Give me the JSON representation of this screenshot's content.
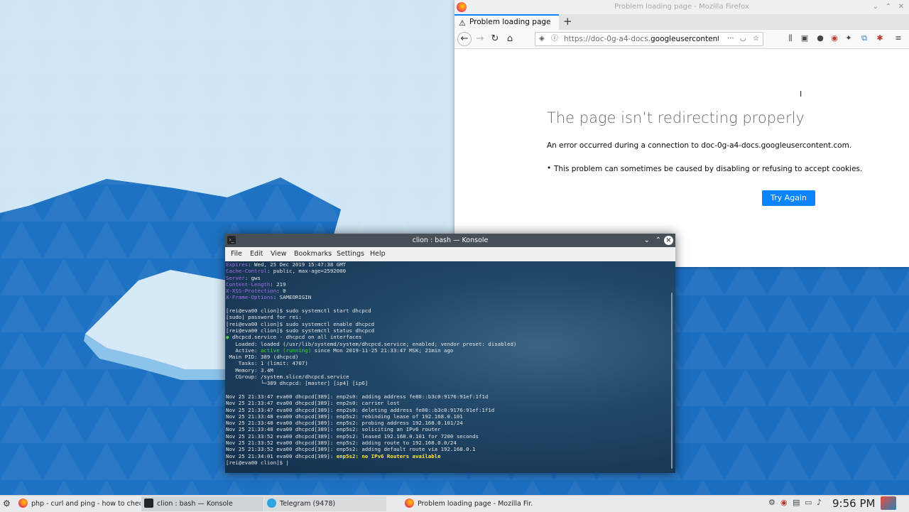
{
  "firefox": {
    "window_title": "Problem loading page - Mozilla Firefox",
    "tab_label": "Problem loading page",
    "url_prefix": "https://doc-0g-a4-docs.",
    "url_host": "googleusercontent.com",
    "error_title": "The page isn’t redirecting properly",
    "error_desc": "An error occurred during a connection to doc-0g-a4-docs.googleusercontent.com.",
    "error_bullet": "This problem can sometimes be caused by disabling or refusing to accept cookies.",
    "try_again_label": "Try Again"
  },
  "konsole": {
    "window_title": "clion : bash — Konsole",
    "menu": [
      "File",
      "Edit",
      "View",
      "Bookmarks",
      "Settings",
      "Help"
    ],
    "lines": [
      {
        "k": "Expires",
        "v": ": Wed, 25 Dec 2019 15:47:38 GMT"
      },
      {
        "k": "Cache-Control",
        "v": ": public, max-age=2592000"
      },
      {
        "k": "Server",
        "v": ": gws"
      },
      {
        "k": "Content-Length",
        "v": ": 219"
      },
      {
        "k": "X-XSS-Protection",
        "v": ": 0"
      },
      {
        "k": "X-Frame-Options",
        "v": ": SAMEORIGIN"
      },
      {
        "t": ""
      },
      {
        "t": "[rei@eva00 clion]$ sudo systemctl start dhcpcd"
      },
      {
        "t": "[sudo] password for rei:"
      },
      {
        "t": "[rei@eva00 clion]$ sudo systemctl enable dhcpcd"
      },
      {
        "t": "[rei@eva00 clion]$ sudo systemctl status dhcpcd"
      },
      {
        "dot": "●",
        "t": " dhcpcd.service - dhcpcd on all interfaces"
      },
      {
        "t": "   Loaded: loaded (/usr/lib/systemd/system/dhcpcd.service; enabled; vendor preset: disabled)"
      },
      {
        "pre": "   Active: ",
        "g": "active (running)",
        "t": " since Mon 2019-11-25 21:33:47 MSK; 21min ago"
      },
      {
        "t": " Main PID: 389 (dhcpcd)"
      },
      {
        "t": "    Tasks: 1 (limit: 4707)"
      },
      {
        "t": "   Memory: 3.4M"
      },
      {
        "t": "   CGroup: /system.slice/dhcpcd.service"
      },
      {
        "t": "           └─389 dhcpcd: [master] [ip4] [ip6]"
      },
      {
        "t": ""
      },
      {
        "t": "Nov 25 21:33:47 eva00 dhcpcd[389]: enp2s0: adding address fe80::b3c0:9176:91ef:1f1d"
      },
      {
        "t": "Nov 25 21:33:47 eva00 dhcpcd[389]: enp2s0: carrier lost"
      },
      {
        "t": "Nov 25 21:33:47 eva00 dhcpcd[389]: enp2s0: deleting address fe80::b3c0:9176:91ef:1f1d"
      },
      {
        "t": "Nov 25 21:33:48 eva00 dhcpcd[389]: enp5s2: rebinding lease of 192.168.0.101"
      },
      {
        "t": "Nov 25 21:33:48 eva00 dhcpcd[389]: enp5s2: probing address 192.168.0.101/24"
      },
      {
        "t": "Nov 25 21:33:48 eva00 dhcpcd[389]: enp5s2: soliciting an IPv6 router"
      },
      {
        "t": "Nov 25 21:33:52 eva00 dhcpcd[389]: enp5s2: leased 192.168.0.101 for 7200 seconds"
      },
      {
        "t": "Nov 25 21:33:52 eva00 dhcpcd[389]: enp5s2: adding route to 192.168.0.0/24"
      },
      {
        "t": "Nov 25 21:33:52 eva00 dhcpcd[389]: enp5s2: adding default route via 192.168.0.1"
      },
      {
        "t": "Nov 25 21:34:01 eva00 dhcpcd[389]: ",
        "y": "enp5s2: no IPv6 Routers available"
      },
      {
        "t": "[rei@eva00 clion]$ |"
      }
    ]
  },
  "taskbar": {
    "items": [
      {
        "label": "php - curl and ping - how to check ...",
        "icon": "firefox-icon"
      },
      {
        "label": "clion : bash — Konsole",
        "icon": "terminal-icon"
      },
      {
        "label": "Telegram (9478)",
        "icon": "telegram-icon"
      },
      {
        "label": "Problem loading page - Mozilla Fir...",
        "icon": "firefox-icon"
      }
    ],
    "clock": "9:56 PM"
  },
  "colors": {
    "accent": "#0a84ff",
    "konsole_bg": "#1a3a58",
    "purple_keys": "#a56ee8",
    "running_green": "#47d147",
    "warn_yellow": "#ffe34d"
  }
}
